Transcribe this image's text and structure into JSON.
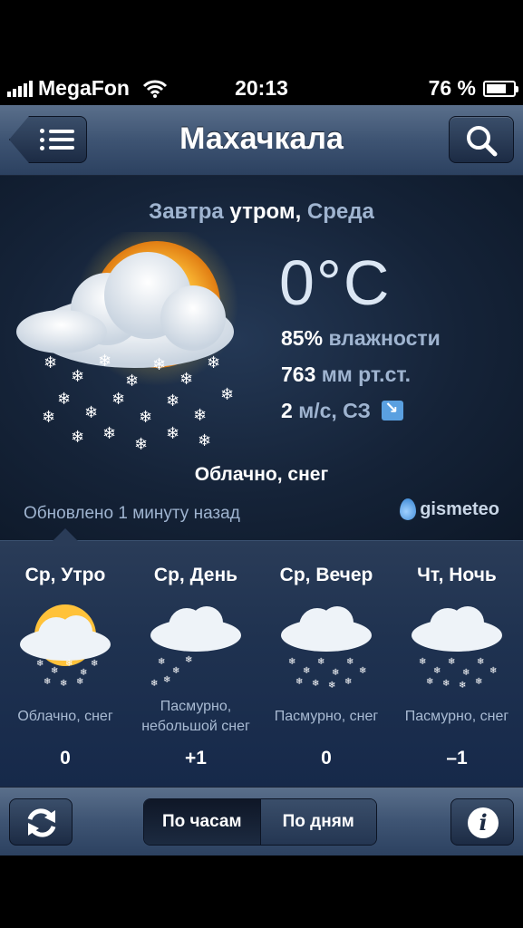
{
  "status": {
    "carrier": "MegaFon",
    "time": "20:13",
    "battery": "76 %",
    "battery_level": 0.76
  },
  "header": {
    "title": "Махачкала"
  },
  "current": {
    "when_1": "Завтра",
    "when_2": "утром,",
    "when_3": "Среда",
    "temperature": "0°C",
    "humidity_value": "85%",
    "humidity_label": "влажности",
    "pressure_value": "763",
    "pressure_label": "мм рт.ст.",
    "wind_value": "2",
    "wind_label": "м/с, СЗ",
    "condition": "Облачно, снег",
    "updated": "Обновлено 1 минуту назад",
    "brand": "gismeteo"
  },
  "forecast": [
    {
      "period": "Ср, Утро",
      "desc": "Облачно, снег",
      "temp": "0",
      "icon": "sun-cloud-snow-icon"
    },
    {
      "period": "Ср, День",
      "desc": "Пасмурно, небольшой снег",
      "temp": "+1",
      "icon": "cloud-light-snow-icon"
    },
    {
      "period": "Ср, Вечер",
      "desc": "Пасмурно, снег",
      "temp": "0",
      "icon": "cloud-snow-icon"
    },
    {
      "period": "Чт, Ночь",
      "desc": "Пасмурно, снег",
      "temp": "–1",
      "icon": "cloud-snow-icon"
    }
  ],
  "toolbar": {
    "hourly": "По часам",
    "daily": "По дням"
  }
}
